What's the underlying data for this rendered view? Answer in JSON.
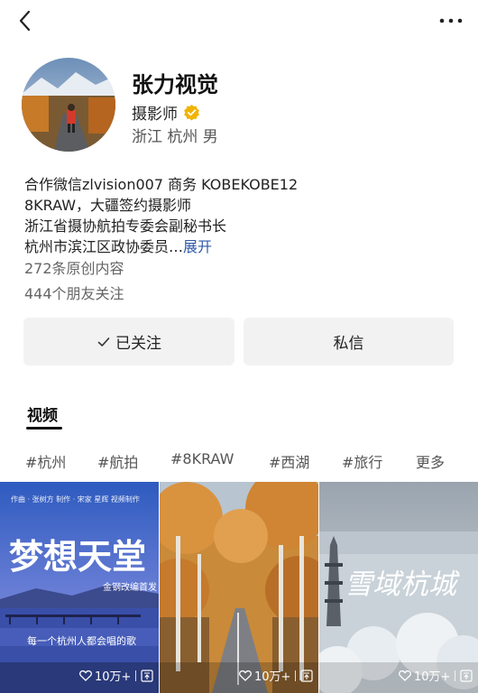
{
  "header": {
    "back_icon": "chevron-left-icon",
    "more_icon": "ellipsis-icon"
  },
  "profile": {
    "name": "张力视觉",
    "role": "摄影师",
    "location": "浙江 杭州 男",
    "verified_color": "#f0b400",
    "bio_lines": [
      "合作微信zlvision007 商务 KOBEKOBE12",
      "8KRAW，大疆签约摄影师",
      "浙江省摄协航拍专委会副秘书长",
      "杭州市滨江区政协委员…"
    ],
    "expand_label": "展开",
    "original_count": "272条原创内容",
    "friends_follow": "444个朋友关注"
  },
  "actions": {
    "follow_label": "已关注",
    "message_label": "私信"
  },
  "tabs": {
    "video_label": "视频"
  },
  "tags": [
    "#杭州",
    "#航拍",
    "#8KRAW",
    "#西湖",
    "#旅行",
    "更多"
  ],
  "videos": [
    {
      "title": "梦想天堂",
      "subtitle": "每一个杭州人都会唱的歌",
      "small_label": "金钢改编首发",
      "credits": "作曲 · 张树方   制作 · 宋家 星辉   视频制作",
      "likes": "10万+"
    },
    {
      "likes": "10万+"
    },
    {
      "title": "雪域杭城",
      "likes": "10万+"
    }
  ],
  "colors": {
    "link": "#2f5aa8",
    "button_bg": "#f2f2f2"
  }
}
